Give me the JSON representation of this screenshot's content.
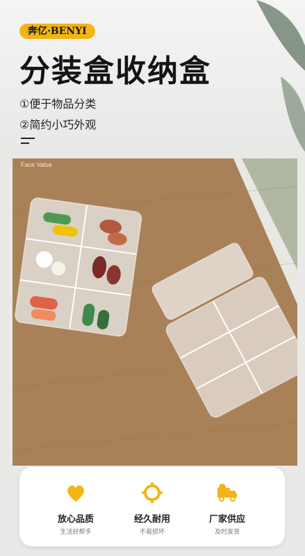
{
  "header": {
    "brand_badge": "奔亿·BENYI",
    "title": "分装盒收纳盒",
    "features": [
      "①便于物品分类",
      "②简约小巧外观"
    ]
  },
  "photo": {
    "watermark": "Face Value"
  },
  "benefits": [
    {
      "icon": "heart-icon",
      "title": "放心品质",
      "subtitle": "生活好帮手"
    },
    {
      "icon": "ring-icon",
      "title": "经久耐用",
      "subtitle": "不易损坏"
    },
    {
      "icon": "truck-icon",
      "title": "厂家供应",
      "subtitle": "及时发货"
    }
  ],
  "colors": {
    "accent": "#f2b515",
    "wood": "#a98158"
  }
}
